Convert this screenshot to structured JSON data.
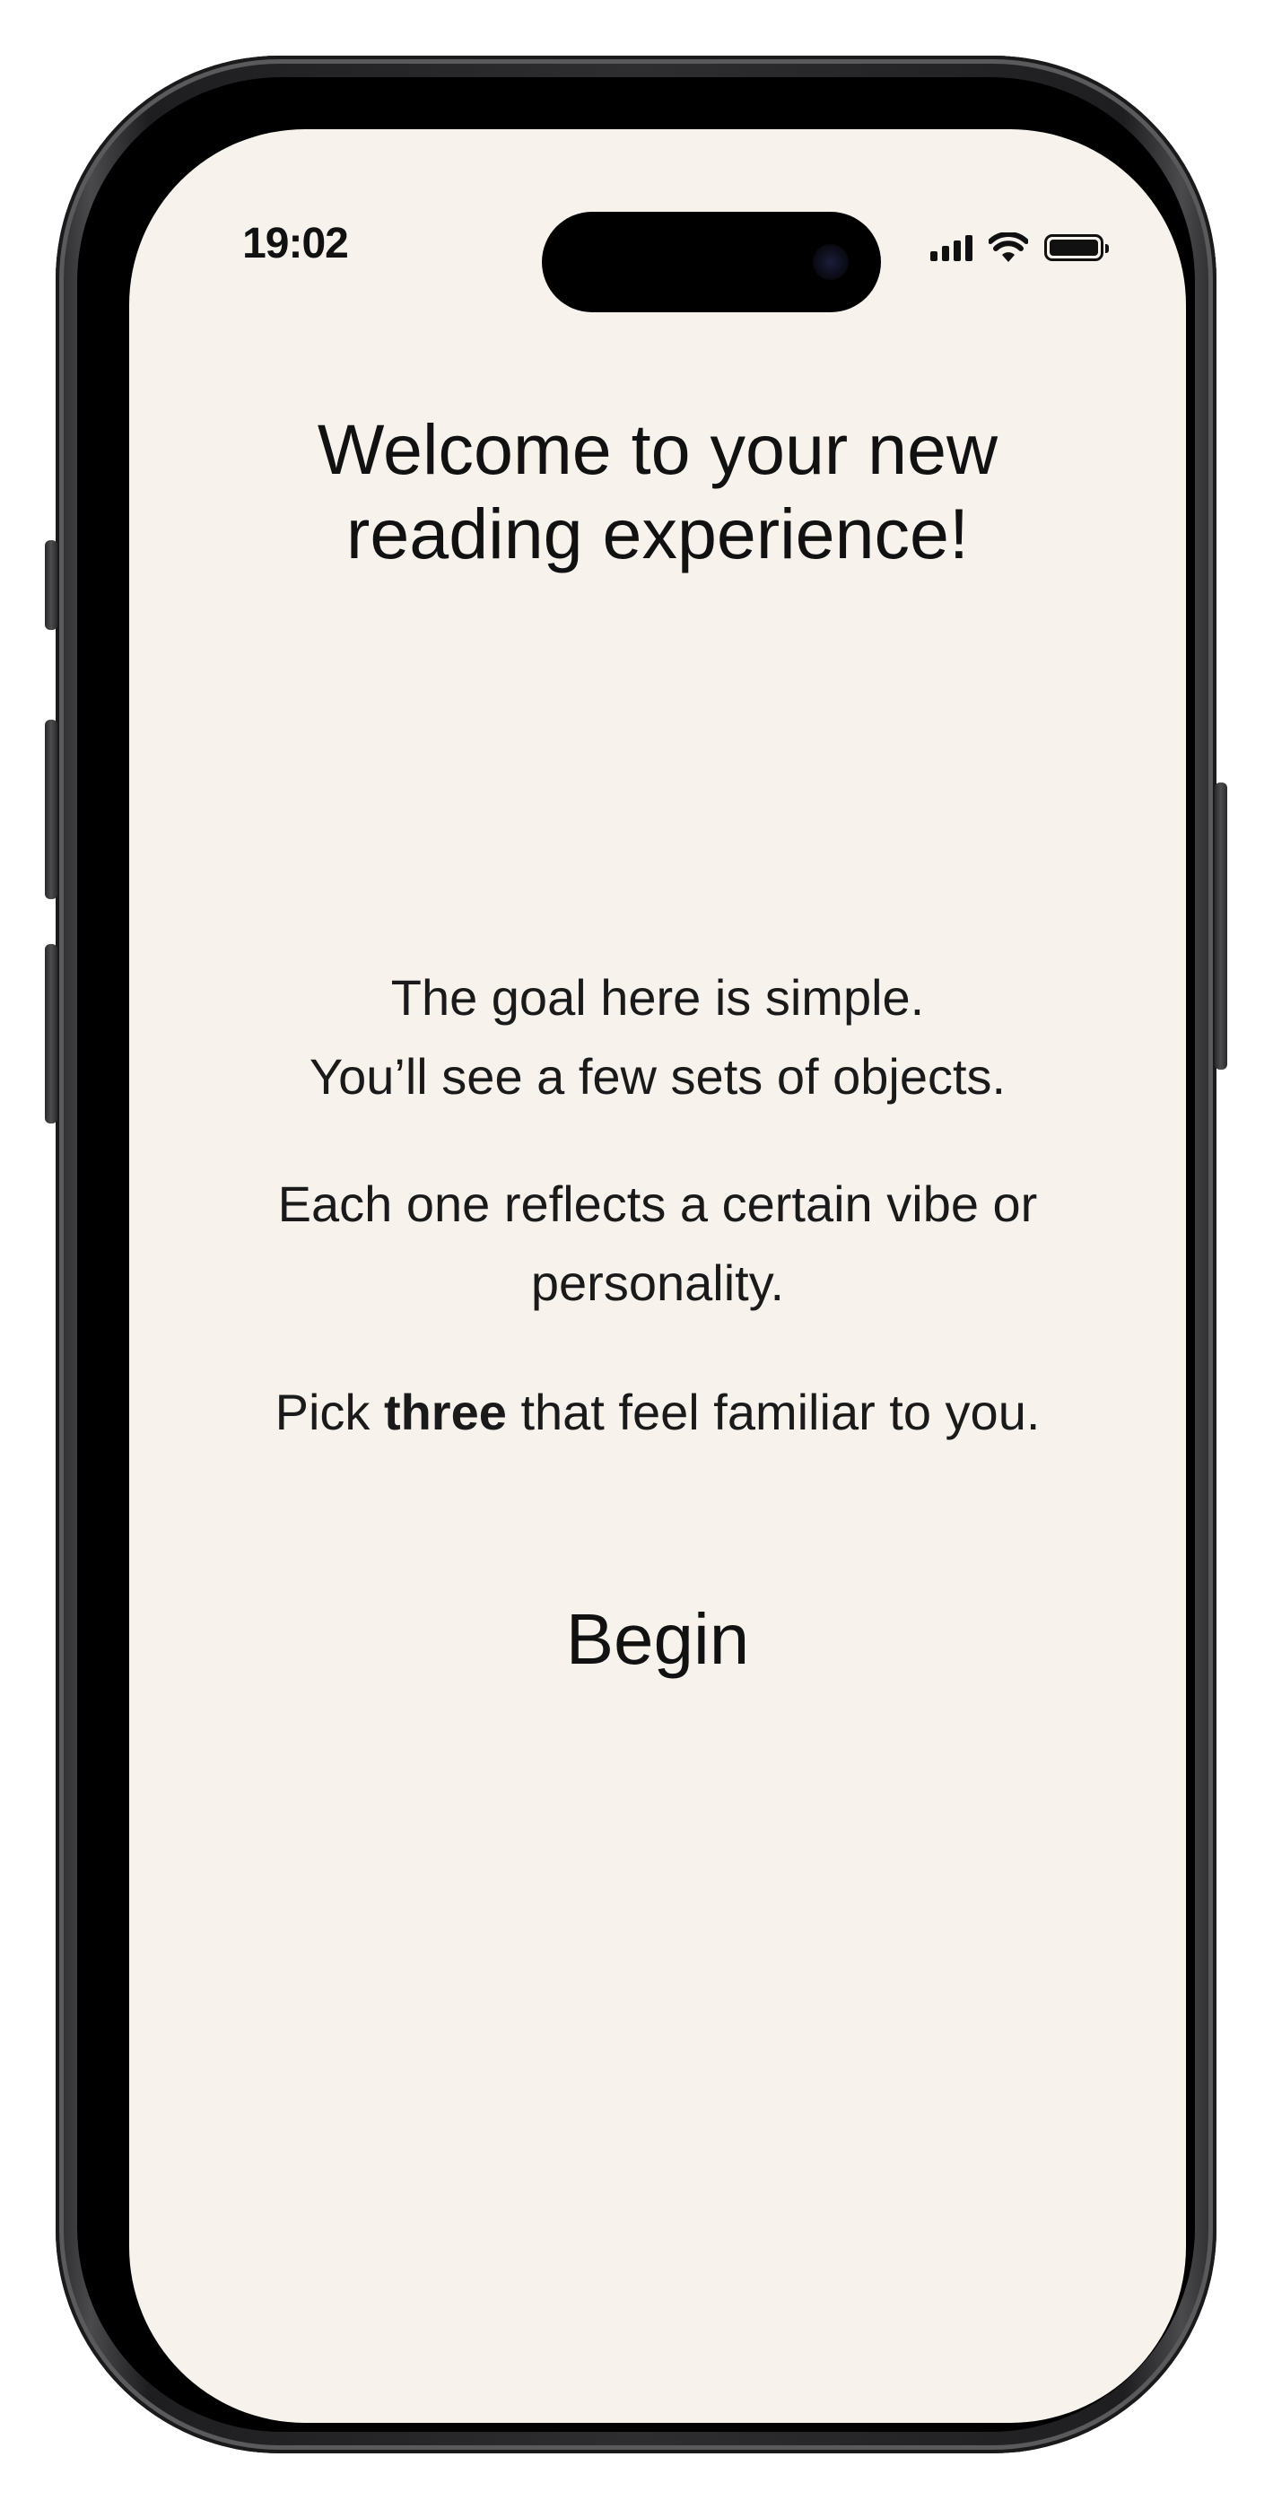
{
  "status_bar": {
    "time": "19:02",
    "icons": [
      "cellular-signal-icon",
      "wifi-icon",
      "battery-icon"
    ],
    "battery_level": 1.0
  },
  "onboarding": {
    "title_lines": [
      "Welcome to your new",
      "reading experience!"
    ],
    "paragraph1_lines": [
      "The goal here is simple.",
      "You’ll see a few sets of objects."
    ],
    "paragraph2_lines": [
      "Each one reflects a certain vibe or",
      "personality."
    ],
    "paragraph3": {
      "prefix": "Pick ",
      "emphasis": "three",
      "suffix": " that feel familiar to you."
    },
    "begin_label": "Begin"
  },
  "colors": {
    "screen_background": "#f7f3ec",
    "text": "#141414",
    "device_frame": "#2e2e30"
  }
}
